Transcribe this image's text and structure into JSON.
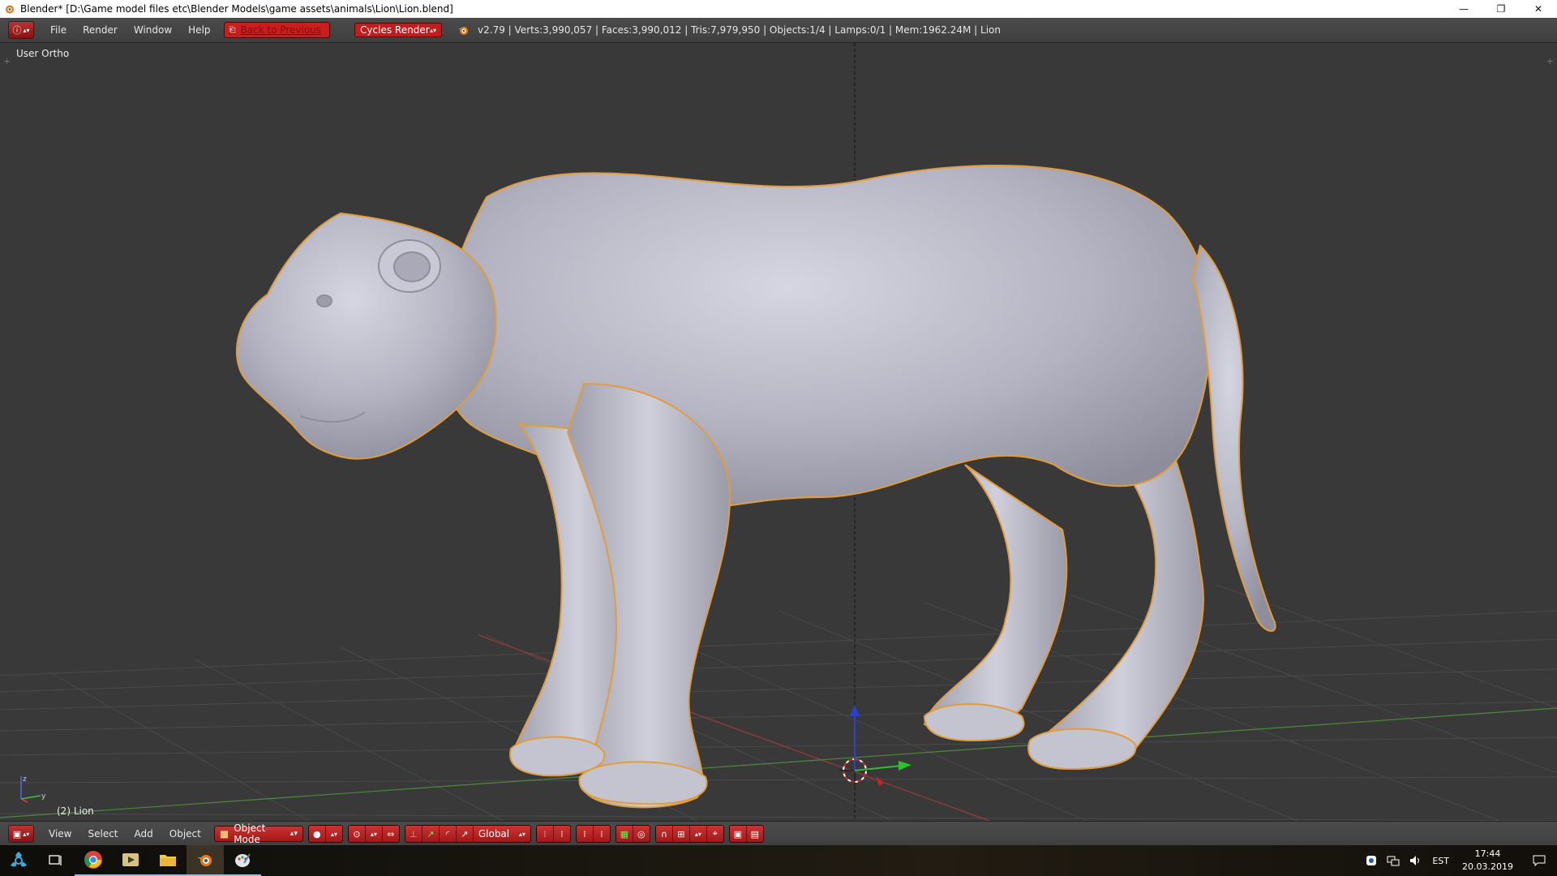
{
  "titlebar": {
    "title": "Blender* [D:\\Game model files etc\\Blender Models\\game assets\\animals\\Lion\\Lion.blend]",
    "minimize": "—",
    "restore": "❐",
    "close": "✕"
  },
  "info_header": {
    "editor_icon": "info-icon",
    "menus": [
      "File",
      "Render",
      "Window",
      "Help"
    ],
    "back_button": "Back to Previous",
    "render_engine": "Cycles Render",
    "stats": "v2.79 | Verts:3,990,057 | Faces:3,990,012 | Tris:7,979,950 | Objects:1/4 | Lamps:0/1 | Mem:1962.24M | Lion"
  },
  "viewport": {
    "view_name": "User Ortho",
    "active_object": "(2) Lion",
    "axis_labels": {
      "z": "z",
      "y": "y"
    },
    "colors": {
      "background": "#393939",
      "grid": "#4a4a4a",
      "x_axis": "#9b3a3a",
      "y_axis": "#4c8a3a",
      "selection_outline": "#e39c3c",
      "model": "#b9b9c7"
    }
  },
  "view_header": {
    "menus": [
      "View",
      "Select",
      "Add",
      "Object"
    ],
    "mode": "Object Mode",
    "orientation": "Global"
  },
  "taskbar": {
    "apps": [
      "start-icon",
      "task-view-icon",
      "chrome-icon",
      "media-player-icon",
      "file-explorer-icon",
      "blender-icon",
      "paint-icon"
    ],
    "language": "EST",
    "time": "17:44",
    "date": "20.03.2019"
  }
}
